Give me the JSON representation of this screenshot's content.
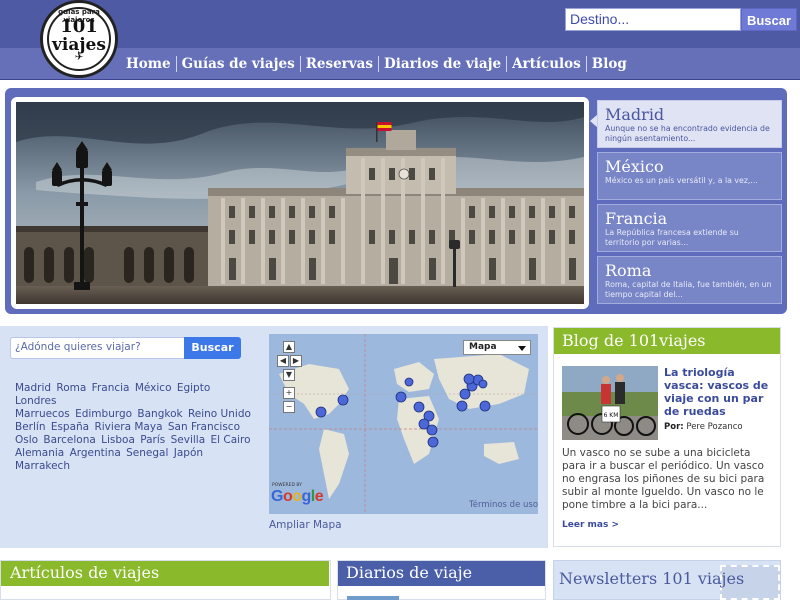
{
  "header": {
    "logo": {
      "top_text": "guías para viajeros",
      "number": "101",
      "word": "viajes"
    },
    "search": {
      "value": "Destino...",
      "button": "Buscar"
    }
  },
  "nav": {
    "items": [
      {
        "label": "Home"
      },
      {
        "label": "Guías de viajes"
      },
      {
        "label": "Reservas"
      },
      {
        "label": "Diarios de viaje"
      },
      {
        "label": "Artículos"
      },
      {
        "label": "Blog"
      }
    ]
  },
  "slider": {
    "items": [
      {
        "title": "Madrid",
        "desc": "Aunque no se ha encontrado evidencia de ningún asentamiento..."
      },
      {
        "title": "México",
        "desc": "México es un país versátil y, a la vez,..."
      },
      {
        "title": "Francia",
        "desc": "La República francesa extiende su territorio por varias..."
      },
      {
        "title": "Roma",
        "desc": "Roma, capital de Italia, fue también, en un tiempo capital del..."
      }
    ]
  },
  "where": {
    "placeholder": "¿Adónde quieres viajar?",
    "button": "Buscar",
    "destinations": [
      "Madrid",
      "Roma",
      "Francia",
      "México",
      "Egipto",
      "Londres",
      "Marruecos",
      "Edimburgo",
      "Bangkok",
      "Reino Unido",
      "Berlín",
      "España",
      "Riviera Maya",
      "San Francisco",
      "Oslo",
      "Barcelona",
      "Lisboa",
      "París",
      "Sevilla",
      "El Cairo",
      "Alemania",
      "Argentina",
      "Senegal",
      "Japón",
      "Marrakech"
    ]
  },
  "map": {
    "type": "Mapa",
    "powered": "POWERED BY",
    "google": "Google",
    "terms": "Términos de uso",
    "expand": "Ampliar Mapa",
    "controls": [
      "up",
      "left",
      "right",
      "down",
      "zoom-in",
      "zoom-out"
    ]
  },
  "blog": {
    "title": "Blog de 101viajes",
    "post_title": "La triología vasca: vascos de viaje con un par de ruedas",
    "author_label": "Por:",
    "author": "Pere Pozanco",
    "excerpt": "Un vasco no se sube a una bicicleta para ir a buscar el periódico. Un vasco no engrasa los piñones de su bici para subir al monte Igueldo. Un vasco no le pone timbre a la bici para...",
    "more": "Leer mas >",
    "sign_text": "6 KM"
  },
  "sections": {
    "articles": "Artículos de viajes",
    "diaries": "Diarios de viaje",
    "newsletter": "Newsletters 101 viajes"
  },
  "colors": {
    "header": "#4e5aa3",
    "nav": "#6570b8",
    "slider": "#5e6cbb",
    "green": "#8ab92b",
    "light_blue_panel": "#d7e2f5"
  }
}
